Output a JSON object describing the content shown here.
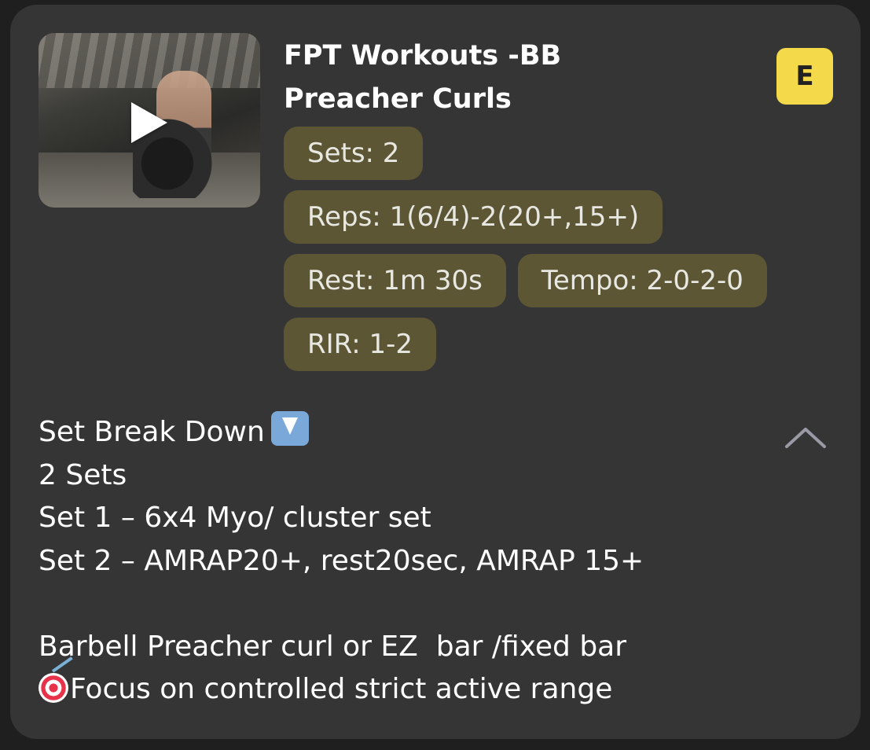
{
  "workout": {
    "title_line1": "FPT Workouts -BB",
    "title_line2": "Preacher Curls",
    "badge": "E",
    "thumbnail_icon": "play-icon",
    "chips": [
      [
        "Sets: 2"
      ],
      [
        "Reps: 1(6/4)-2(20+,15+)"
      ],
      [
        "Rest: 1m 30s",
        "Tempo: 2-0-2-0"
      ],
      [
        "RIR: 1-2"
      ]
    ]
  },
  "description": {
    "line1": "Set Break Down",
    "line1_icon": "down-arrow-emoji-icon",
    "line2": "2 Sets",
    "line3": "Set 1 – 6x4 Myo/ cluster set",
    "line4": "Set 2 – AMRAP20+, rest20sec, AMRAP 15+",
    "line5": "",
    "line6": "Barbell Preacher curl or EZ  bar /fixed bar",
    "line7": "Focus on controlled strict active range",
    "line7_icon": "target-emoji-icon",
    "collapse_icon": "chevron-up-icon"
  },
  "colors": {
    "background": "#1f1f1f",
    "card": "#353535",
    "chip": "#5d5634",
    "badge": "#f4d94a",
    "text": "#ffffff"
  }
}
